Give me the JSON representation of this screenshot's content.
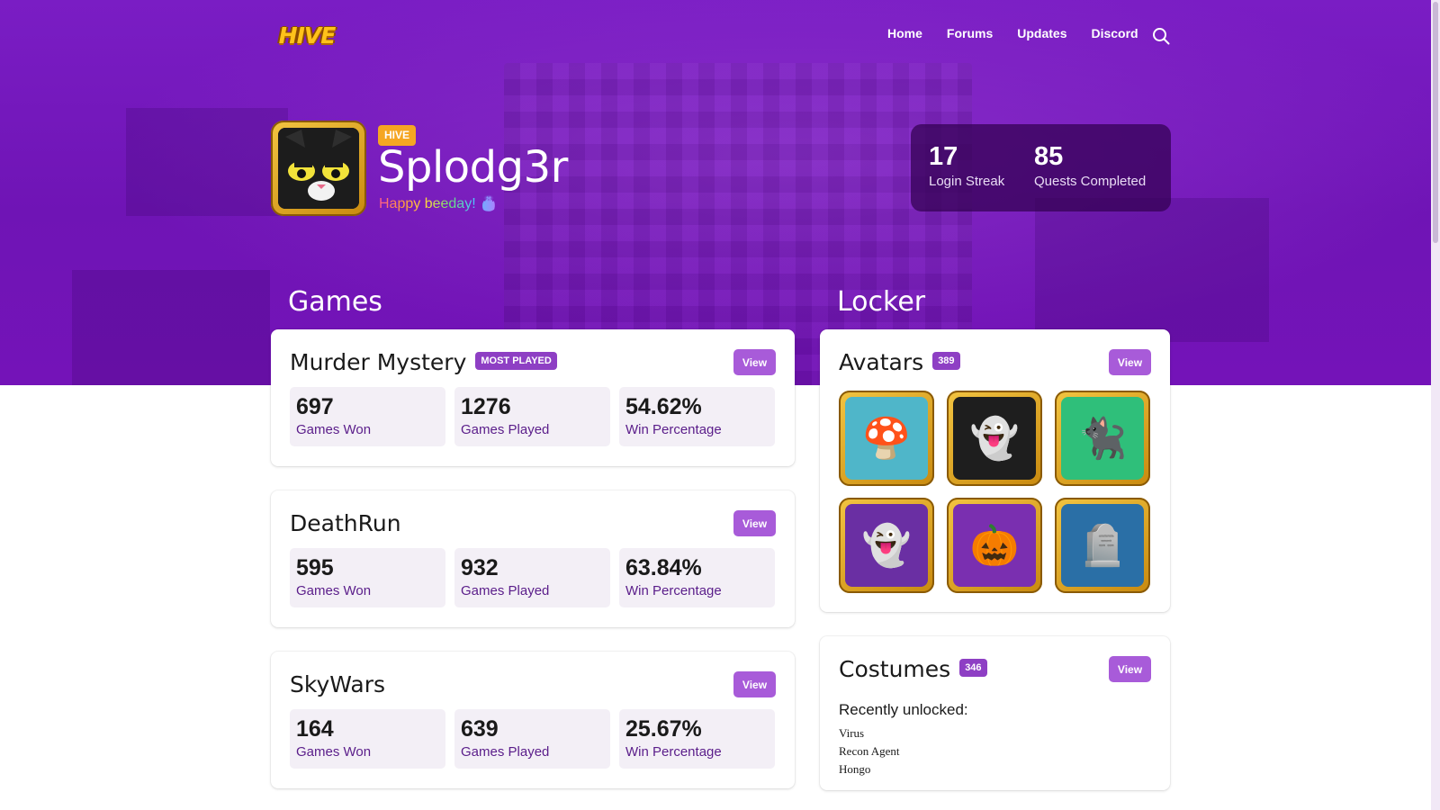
{
  "header": {
    "logo_text": "HIVE",
    "nav": [
      "Home",
      "Forums",
      "Updates",
      "Discord"
    ]
  },
  "profile": {
    "badge": "HIVE",
    "username": "Splodg3r",
    "tagline": "Happy beeday! 🎂",
    "login_streak": {
      "value": "17",
      "label": "Login Streak"
    },
    "quests": {
      "value": "85",
      "label": "Quests Completed"
    }
  },
  "games_section": {
    "title": "Games",
    "view_label": "View",
    "games": [
      {
        "name": "Murder Mystery",
        "tag": "MOST PLAYED",
        "stats": [
          {
            "value": "697",
            "label": "Games Won"
          },
          {
            "value": "1276",
            "label": "Games Played"
          },
          {
            "value": "54.62%",
            "label": "Win Percentage"
          }
        ]
      },
      {
        "name": "DeathRun",
        "stats": [
          {
            "value": "595",
            "label": "Games Won"
          },
          {
            "value": "932",
            "label": "Games Played"
          },
          {
            "value": "63.84%",
            "label": "Win Percentage"
          }
        ]
      },
      {
        "name": "SkyWars",
        "stats": [
          {
            "value": "164",
            "label": "Games Won"
          },
          {
            "value": "639",
            "label": "Games Played"
          },
          {
            "value": "25.67%",
            "label": "Win Percentage"
          }
        ]
      }
    ]
  },
  "locker": {
    "title": "Locker",
    "avatars": {
      "title": "Avatars",
      "count": "389",
      "view_label": "View",
      "items": [
        {
          "icon": "mushroom-icon",
          "glyph": "🍄",
          "bg": "#4fb6c9"
        },
        {
          "icon": "ghost-hat-icon",
          "glyph": "👻",
          "bg": "#1e1e1e"
        },
        {
          "icon": "witch-cat-icon",
          "glyph": "🐈‍⬛",
          "bg": "#2fbf7a"
        },
        {
          "icon": "party-ghosts-icon",
          "glyph": "👻",
          "bg": "#6a2fa3"
        },
        {
          "icon": "pumpkin-skeleton-icon",
          "glyph": "🎃",
          "bg": "#7a2fb0"
        },
        {
          "icon": "gravestone-icon",
          "glyph": "🪦",
          "bg": "#2a6fa6"
        }
      ]
    },
    "costumes": {
      "title": "Costumes",
      "count": "346",
      "view_label": "View",
      "recent_title": "Recently unlocked:",
      "recent": [
        "Virus",
        "Recon Agent",
        "Hongo"
      ]
    }
  }
}
